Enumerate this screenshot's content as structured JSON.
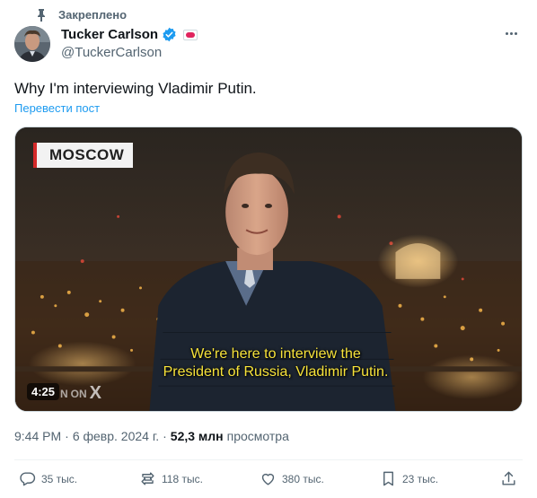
{
  "pinned": {
    "label": "Закреплено",
    "icon": "pin-icon"
  },
  "author": {
    "display_name": "Tucker Carlson",
    "handle": "@TuckerCarlson",
    "verified_color": "#1d9bf0"
  },
  "tweet": {
    "text": "Why I'm interviewing Vladimir Putin.",
    "translate_label": "Перевести пост"
  },
  "video": {
    "location_tag": "MOSCOW",
    "subtitle_line1": "We're here to interview the",
    "subtitle_line2": "President of Russia, Vladimir Putin.",
    "duration": "4:25",
    "watermark": "N",
    "watermark_on": "ON",
    "watermark_x": "X"
  },
  "meta": {
    "time": "9:44 PM",
    "sep1": "·",
    "date": "6 февр. 2024 г.",
    "sep2": "·",
    "views_count": "52,3 млн",
    "views_label": "просмотра"
  },
  "actions": {
    "replies": "35 тыс.",
    "reposts": "118 тыс.",
    "likes": "380 тыс.",
    "bookmarks": "23 тыс."
  },
  "colors": {
    "accent": "#1d9bf0",
    "muted": "#536471",
    "text": "#0f1419"
  }
}
